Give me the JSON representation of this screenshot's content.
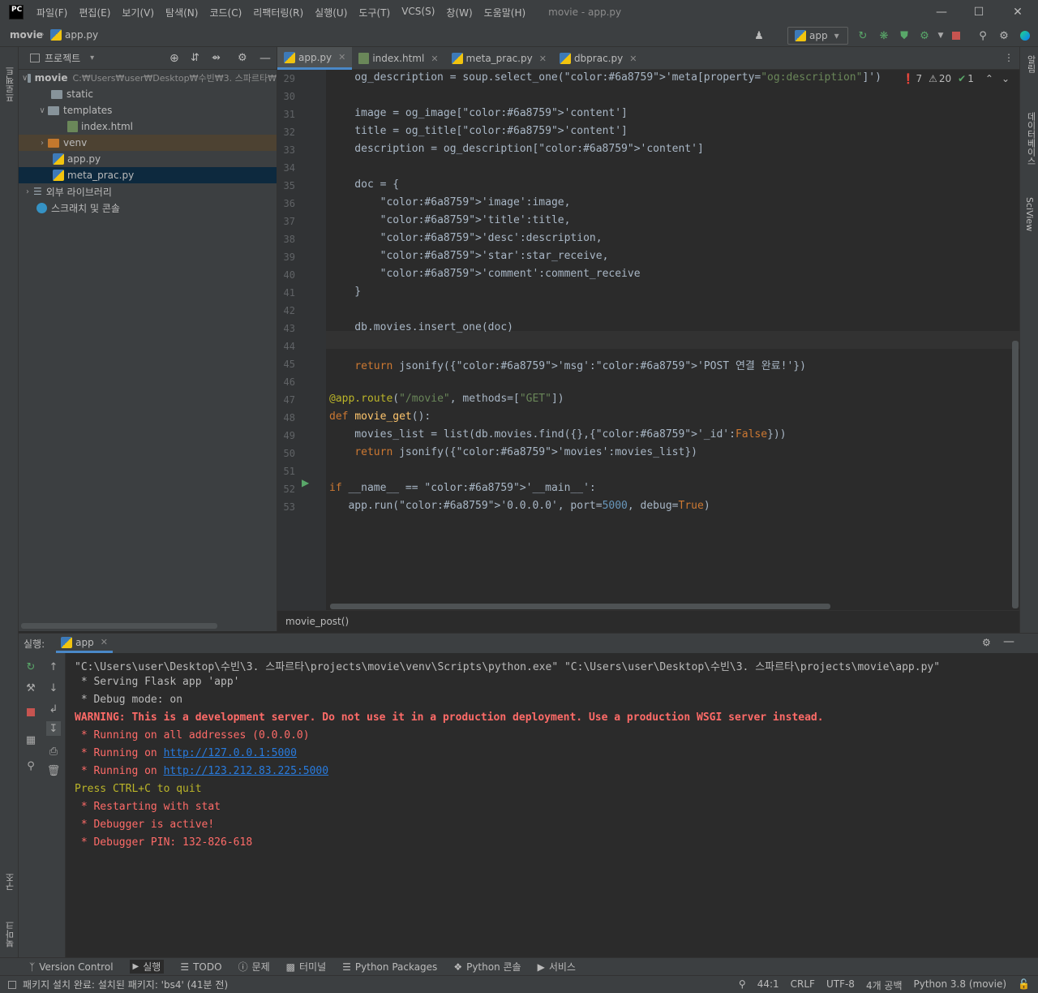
{
  "titlebar": {
    "logo": "PC",
    "menus": [
      "파일(F)",
      "편집(E)",
      "보기(V)",
      "탐색(N)",
      "코드(C)",
      "리팩터링(R)",
      "실행(U)",
      "도구(T)",
      "VCS(S)",
      "창(W)",
      "도움말(H)"
    ],
    "window_title": "movie - app.py",
    "minimize": "—",
    "maximize": "☐",
    "close": "✕"
  },
  "navbar": {
    "project": "movie",
    "separator": "›",
    "file": "app.py",
    "run_config": "app",
    "run_config_arrow": "▾"
  },
  "left_stripe": {
    "project_label": "프로젝트",
    "structure_label": "구조",
    "bookmarks_label": "북마크"
  },
  "right_stripe": {
    "database_label": "데이터베이스",
    "sciview_label": "SciView",
    "notifications_label": "알림"
  },
  "project_panel": {
    "title": "프로젝트",
    "title_arrow": "▾",
    "tree": [
      {
        "label": "movie",
        "path": "C:₩Users₩user₩Desktop₩수빈₩3. 스파르타₩",
        "kind": "root"
      },
      {
        "label": "static",
        "kind": "folder"
      },
      {
        "label": "templates",
        "kind": "folder"
      },
      {
        "label": "index.html",
        "kind": "html"
      },
      {
        "label": "venv",
        "kind": "venv"
      },
      {
        "label": "app.py",
        "kind": "py"
      },
      {
        "label": "meta_prac.py",
        "kind": "py"
      },
      {
        "label": "외부 라이브러리",
        "kind": "lib"
      },
      {
        "label": "스크래치 및 콘솔",
        "kind": "scratch"
      }
    ]
  },
  "editor": {
    "tabs": [
      {
        "label": "app.py",
        "active": true
      },
      {
        "label": "index.html",
        "active": false
      },
      {
        "label": "meta_prac.py",
        "active": false
      },
      {
        "label": "dbprac.py",
        "active": false
      }
    ],
    "tab_close": "✕",
    "inspections": {
      "errors": "7",
      "warnings": "20",
      "ok": "1"
    },
    "breadcrumb": "movie_post()",
    "line_numbers": [
      "29",
      "30",
      "31",
      "32",
      "33",
      "34",
      "35",
      "36",
      "37",
      "38",
      "39",
      "40",
      "41",
      "42",
      "43",
      "44",
      "45",
      "46",
      "47",
      "48",
      "49",
      "50",
      "51",
      "52",
      "53"
    ],
    "code": [
      "    og_description = soup.select_one('meta[property=\"og:description\"]')",
      "",
      "    image = og_image['content']",
      "    title = og_title['content']",
      "    description = og_description['content']",
      "",
      "    doc = {",
      "        'image':image,",
      "        'title':title,",
      "        'desc':description,",
      "        'star':star_receive,",
      "        'comment':comment_receive",
      "    }",
      "",
      "    db.movies.insert_one(doc)",
      "",
      "    return jsonify({'msg':'POST 연결 완료!'})",
      "",
      "@app.route(\"/movie\", methods=[\"GET\"])",
      "def movie_get():",
      "    movies_list = list(db.movies.find({},{'_id':False}))",
      "    return jsonify({'movies':movies_list})",
      "",
      "if __name__ == '__main__':",
      "   app.run('0.0.0.0', port=5000, debug=True)"
    ]
  },
  "run_panel": {
    "label": "실행:",
    "tab": "app",
    "console": [
      {
        "text": "\"C:\\Users\\user\\Desktop\\수빈\\3. 스파르타\\projects\\movie\\venv\\Scripts\\python.exe\" \"C:\\Users\\user\\Desktop\\수빈\\3. 스파르타\\projects\\movie\\app.py\"",
        "style": "normal"
      },
      {
        "text": " * Serving Flask app 'app'",
        "style": "normal"
      },
      {
        "text": " * Debug mode: on",
        "style": "normal"
      },
      {
        "text": "WARNING: This is a development server. Do not use it in a production deployment. Use a production WSGI server instead.",
        "style": "warn"
      },
      {
        "text": " * Running on all addresses (0.0.0.0)",
        "style": "red"
      },
      {
        "text": " * Running on ",
        "style": "red",
        "link": "http://127.0.0.1:5000"
      },
      {
        "text": " * Running on ",
        "style": "red",
        "link": "http://123.212.83.225:5000"
      },
      {
        "text": "Press CTRL+C to quit",
        "style": "yellow"
      },
      {
        "text": " * Restarting with stat",
        "style": "red"
      },
      {
        "text": " * Debugger is active!",
        "style": "red"
      },
      {
        "text": " * Debugger PIN: 132-826-618",
        "style": "red"
      }
    ]
  },
  "toolstrip": [
    "Version Control",
    "실행",
    "TODO",
    "문제",
    "터미널",
    "Python Packages",
    "Python 콘솔",
    "서비스"
  ],
  "statusbar": {
    "message": "패키지 설치 완료: 설치된 패키지: 'bs4' (41분 전)",
    "position": "44:1",
    "line_sep": "CRLF",
    "encoding": "UTF-8",
    "indent": "4개 공백",
    "interpreter": "Python 3.8 (movie)"
  }
}
